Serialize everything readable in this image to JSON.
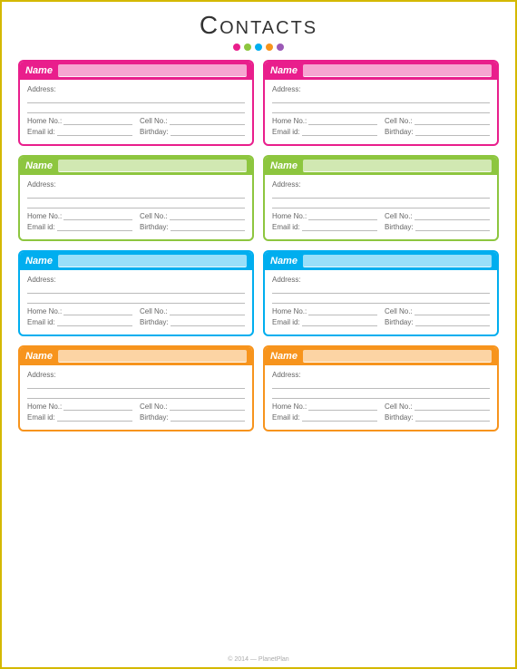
{
  "page": {
    "title": "Contacts",
    "footer": "© 2014 — PlanetPlan",
    "dots": [
      {
        "color": "#e91e8c"
      },
      {
        "color": "#8dc63f"
      },
      {
        "color": "#00aeef"
      },
      {
        "color": "#f7941d"
      },
      {
        "color": "#9b59b6"
      }
    ]
  },
  "cards": [
    {
      "id": "card-1",
      "color": "pink",
      "header_label": "Name",
      "fields": {
        "address_label": "Address:",
        "home_label": "Home No.:",
        "cell_label": "Cell No.:",
        "email_label": "Email id:",
        "birthday_label": "Birthday:"
      }
    },
    {
      "id": "card-2",
      "color": "pink",
      "header_label": "Name",
      "fields": {
        "address_label": "Address:",
        "home_label": "Home No.:",
        "cell_label": "Cell No.:",
        "email_label": "Email id:",
        "birthday_label": "Birthday:"
      }
    },
    {
      "id": "card-3",
      "color": "green",
      "header_label": "Name",
      "fields": {
        "address_label": "Address:",
        "home_label": "Home No.:",
        "cell_label": "Cell No.:",
        "email_label": "Email id:",
        "birthday_label": "Birthday:"
      }
    },
    {
      "id": "card-4",
      "color": "green",
      "header_label": "Name",
      "fields": {
        "address_label": "Address:",
        "home_label": "Home No.:",
        "cell_label": "Cell No.:",
        "email_label": "Email id:",
        "birthday_label": "Birthday:"
      }
    },
    {
      "id": "card-5",
      "color": "blue",
      "header_label": "Name",
      "fields": {
        "address_label": "Address:",
        "home_label": "Home No.:",
        "cell_label": "Cell No.:",
        "email_label": "Email id:",
        "birthday_label": "Birthday:"
      }
    },
    {
      "id": "card-6",
      "color": "blue",
      "header_label": "Name",
      "fields": {
        "address_label": "Address:",
        "home_label": "Home No.:",
        "cell_label": "Cell No.:",
        "email_label": "Email id:",
        "birthday_label": "Birthday:"
      }
    },
    {
      "id": "card-7",
      "color": "yellow",
      "header_label": "Name",
      "fields": {
        "address_label": "Address:",
        "home_label": "Home No.:",
        "cell_label": "Cell No.:",
        "email_label": "Email id:",
        "birthday_label": "Birthday:"
      }
    },
    {
      "id": "card-8",
      "color": "yellow",
      "header_label": "Name",
      "fields": {
        "address_label": "Address:",
        "home_label": "Home No.:",
        "cell_label": "Cell No.:",
        "email_label": "Email id:",
        "birthday_label": "Birthday:"
      }
    }
  ]
}
